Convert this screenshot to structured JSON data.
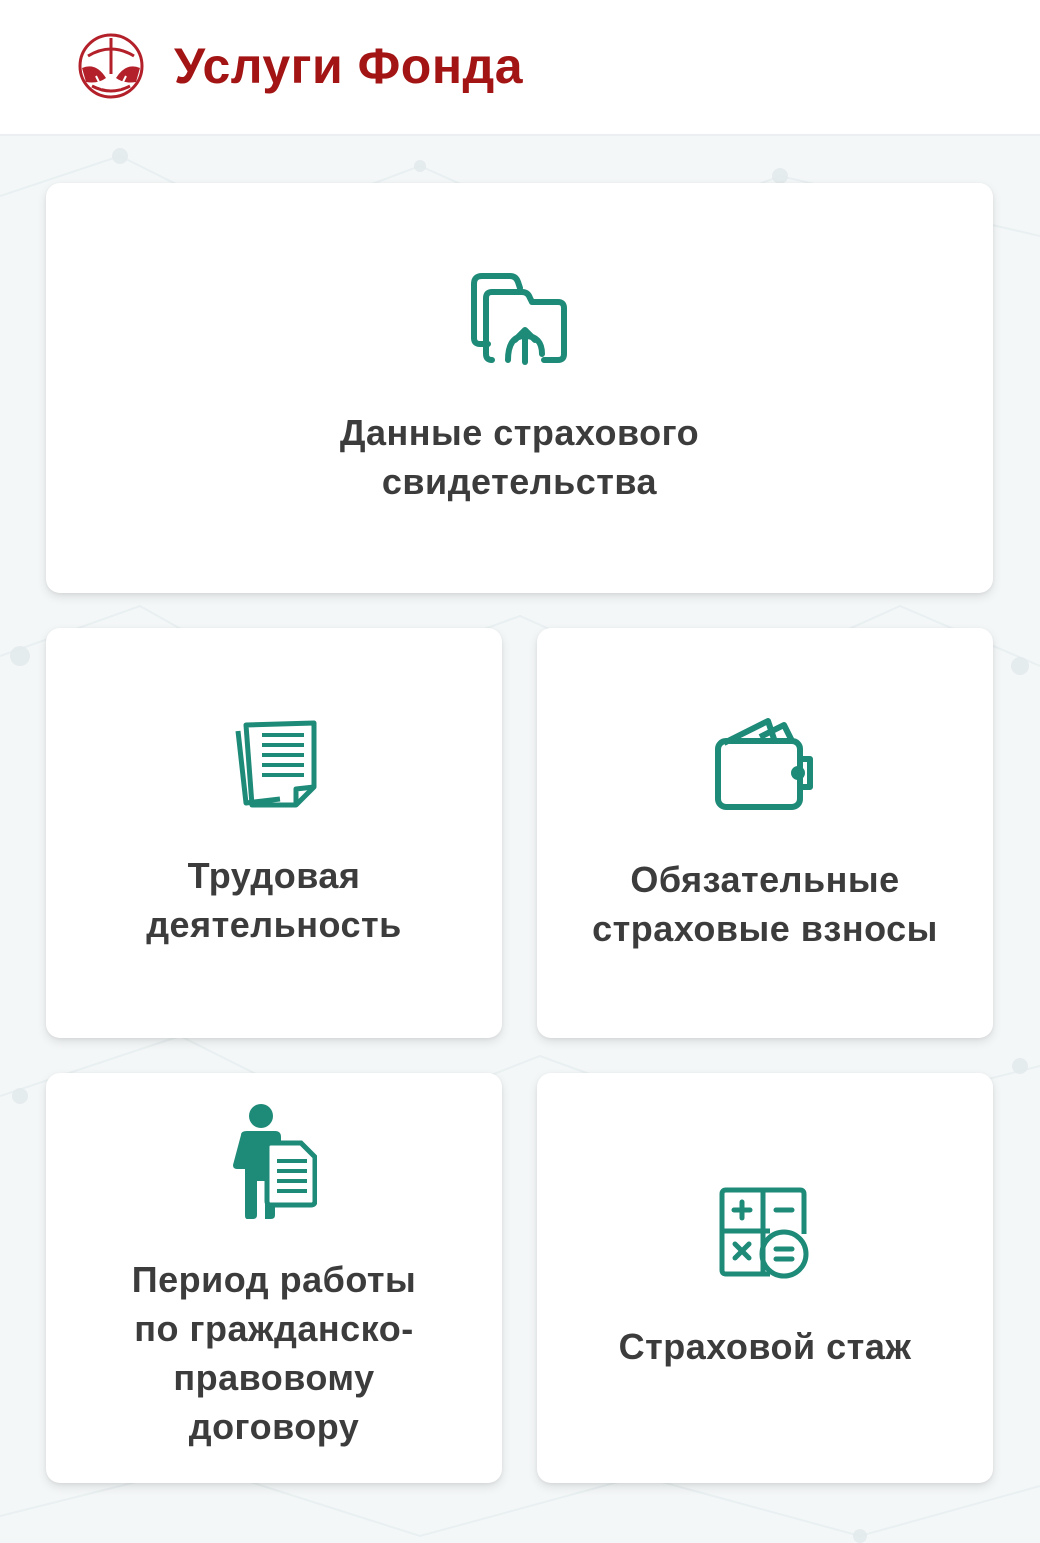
{
  "header": {
    "title": "Услуги Фонда",
    "logo_icon": "fund-emblem-icon",
    "brand_color": "#a31515"
  },
  "accent_color": "#1e8a78",
  "cards": [
    {
      "id": "insurance-certificate",
      "icon": "folder-upload-icon",
      "label": "Данные страхового свидетельства"
    },
    {
      "id": "work-activity",
      "icon": "documents-icon",
      "label": "Трудовая деятельность"
    },
    {
      "id": "mandatory-contributions",
      "icon": "wallet-icon",
      "label": "Обязательные страховые взносы"
    },
    {
      "id": "civil-contract-period",
      "icon": "person-document-icon",
      "label": "Период работы по гражданско-правовому договору"
    },
    {
      "id": "insurance-experience",
      "icon": "calculator-icon",
      "label": "Страховой стаж"
    }
  ]
}
